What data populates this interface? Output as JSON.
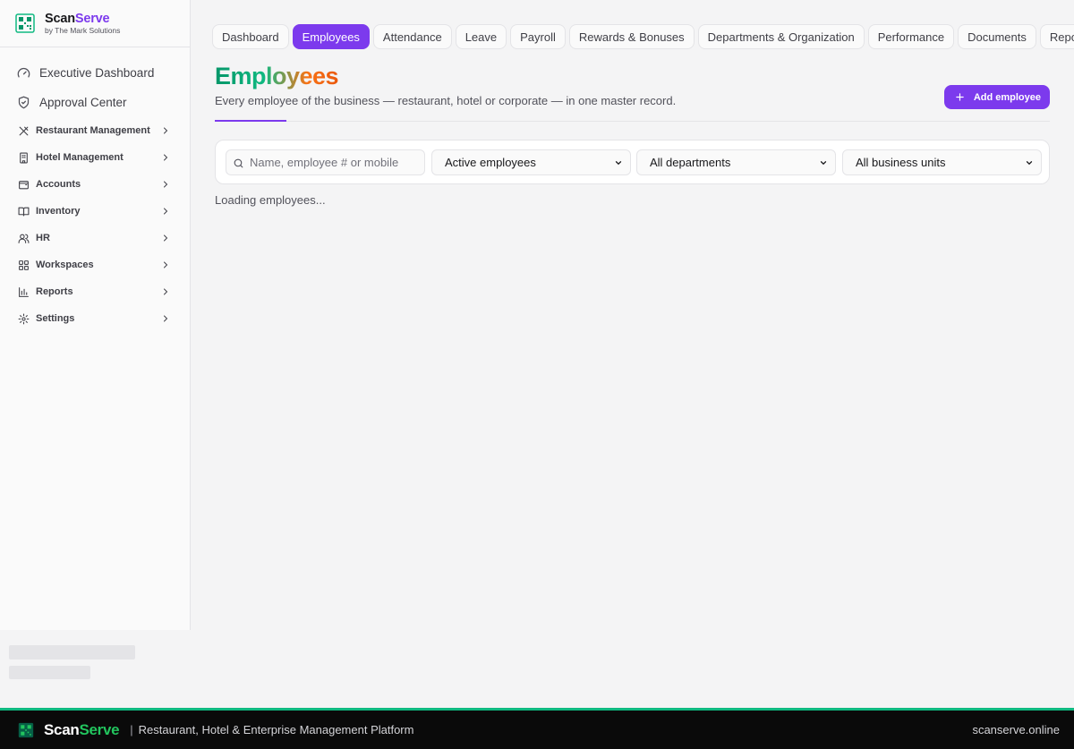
{
  "brand": {
    "name_part1": "Scan",
    "name_part2": "Serve",
    "subtitle": "by The Mark Solutions"
  },
  "sidebar": {
    "top_links": [
      {
        "label": "Executive Dashboard",
        "icon": "gauge-icon"
      },
      {
        "label": "Approval Center",
        "icon": "shield-check-icon"
      }
    ],
    "sections": [
      {
        "label": "Restaurant Management",
        "icon": "utensils-icon"
      },
      {
        "label": "Hotel Management",
        "icon": "building-icon"
      },
      {
        "label": "Accounts",
        "icon": "wallet-icon"
      },
      {
        "label": "Inventory",
        "icon": "book-icon"
      },
      {
        "label": "HR",
        "icon": "users-icon"
      },
      {
        "label": "Workspaces",
        "icon": "grid-icon"
      },
      {
        "label": "Reports",
        "icon": "bar-chart-icon"
      },
      {
        "label": "Settings",
        "icon": "gear-icon"
      }
    ]
  },
  "tabs": [
    {
      "label": "Dashboard",
      "active": false
    },
    {
      "label": "Employees",
      "active": true
    },
    {
      "label": "Attendance",
      "active": false
    },
    {
      "label": "Leave",
      "active": false
    },
    {
      "label": "Payroll",
      "active": false
    },
    {
      "label": "Rewards & Bonuses",
      "active": false
    },
    {
      "label": "Departments & Organization",
      "active": false
    },
    {
      "label": "Performance",
      "active": false
    },
    {
      "label": "Documents",
      "active": false
    },
    {
      "label": "Reports",
      "active": false
    }
  ],
  "page": {
    "title": "Employees",
    "subtitle": "Every employee of the business — restaurant, hotel or corporate — in one master record.",
    "add_button": "Add employee"
  },
  "filters": {
    "search_placeholder": "Name, employee # or mobile",
    "status_value": "Active employees",
    "department_value": "All departments",
    "business_unit_value": "All business units"
  },
  "status_text": "Loading employees...",
  "footer": {
    "brand_part1": "Scan",
    "brand_part2": "Serve",
    "separator": "|",
    "tagline": "Restaurant, Hotel & Enterprise Management Platform",
    "url": "scanserve.online"
  },
  "colors": {
    "accent": "#7c3aed",
    "brand_green": "#10b981",
    "brand_orange": "#f97316"
  }
}
